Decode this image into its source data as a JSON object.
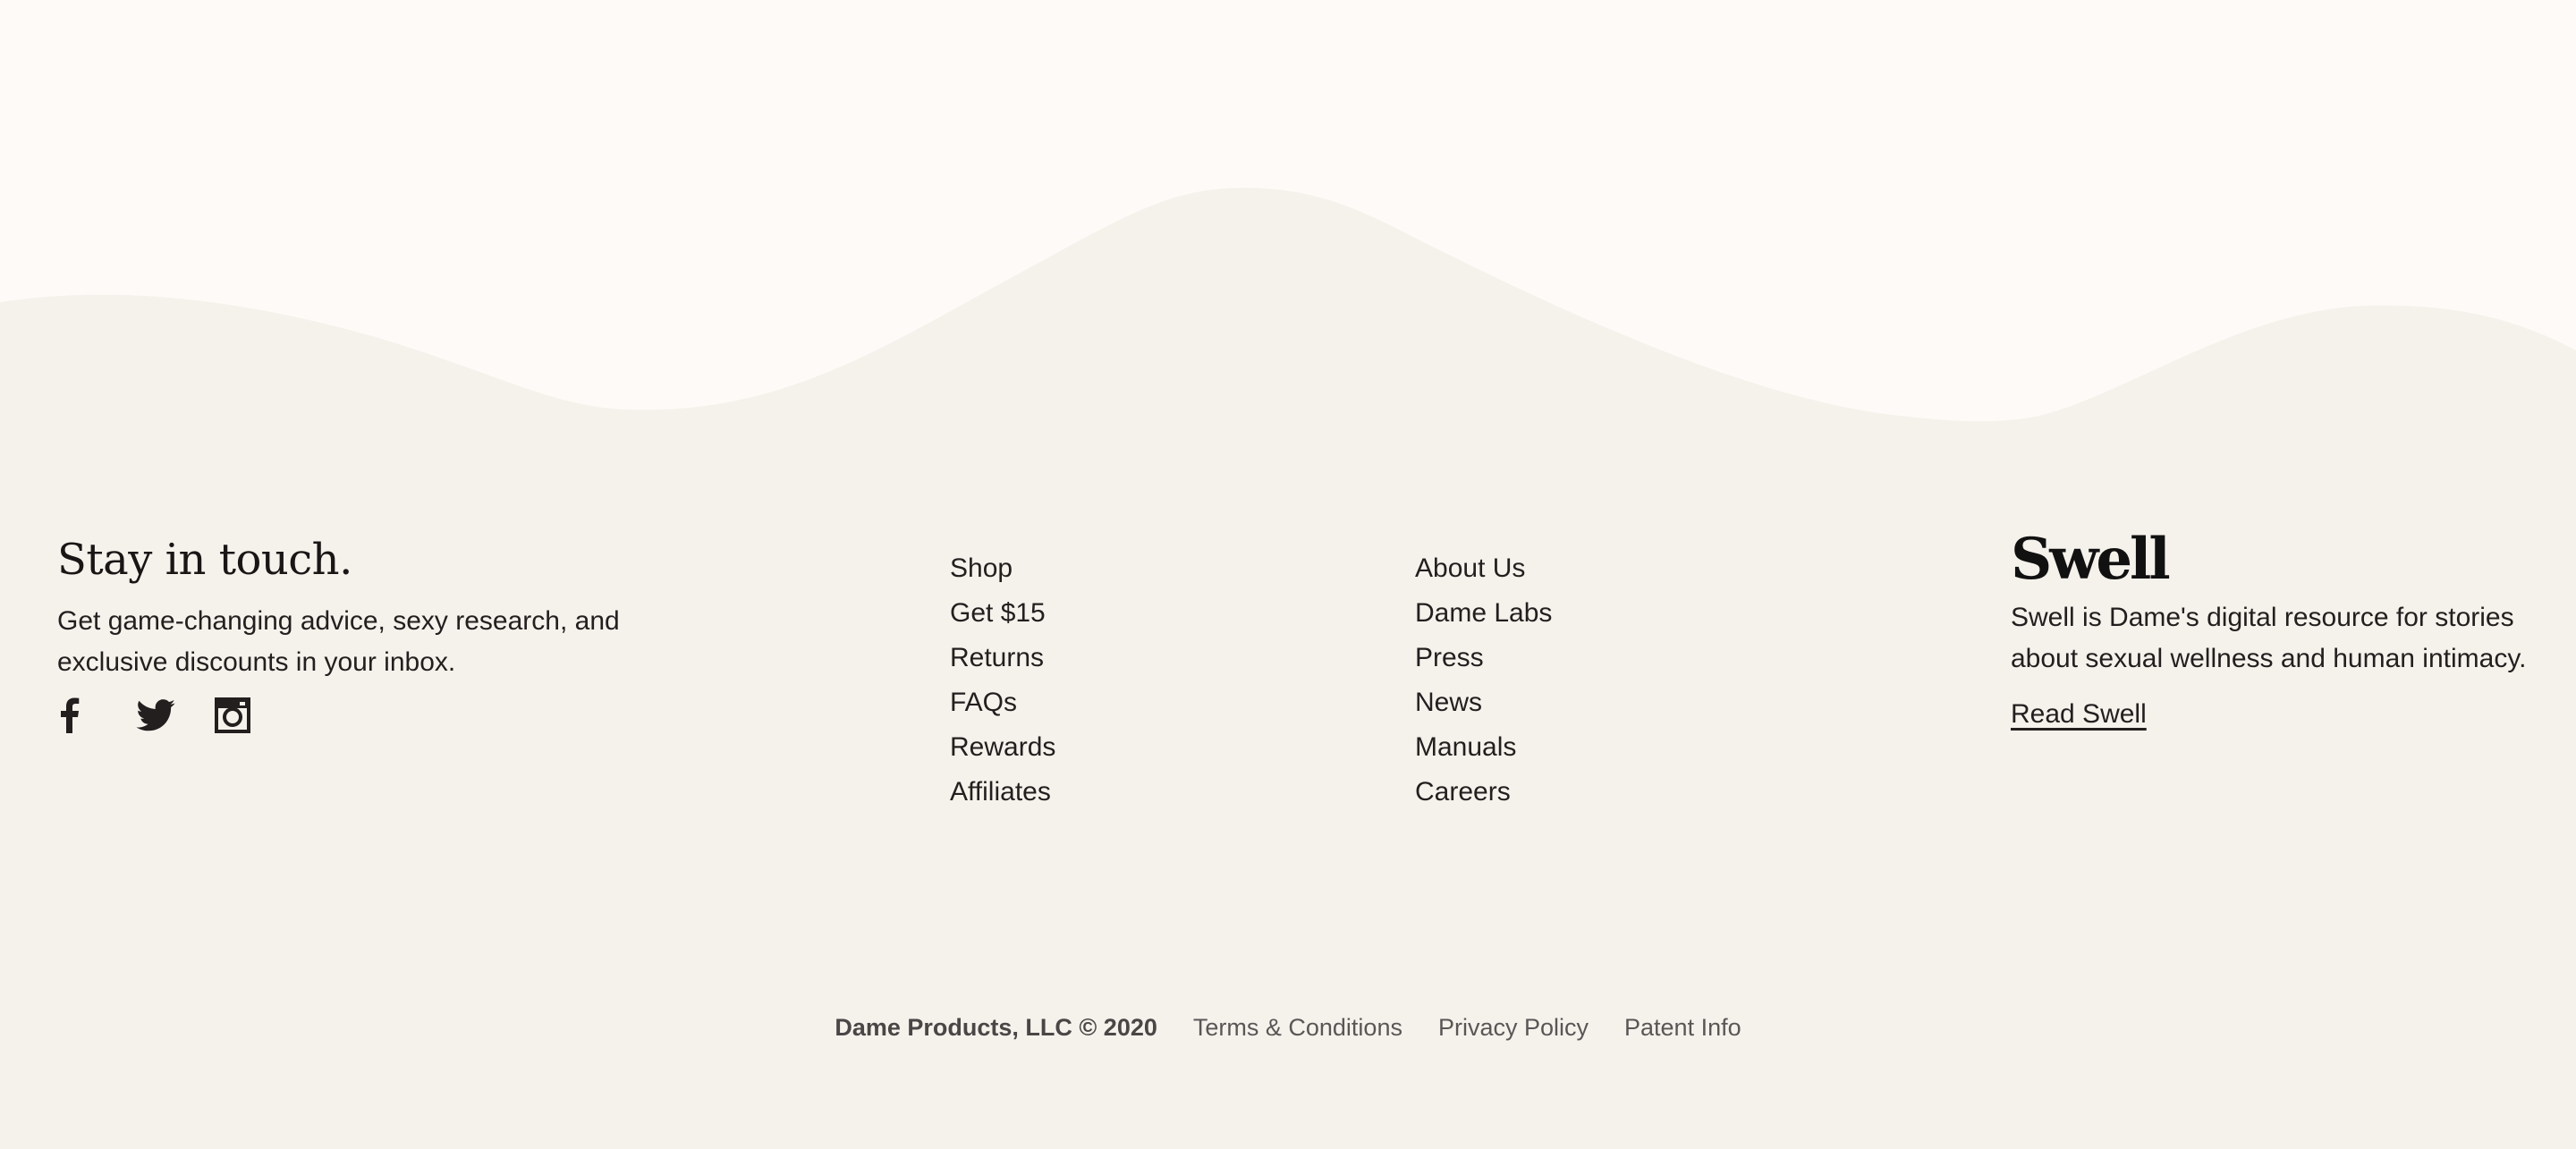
{
  "colors": {
    "page_background": "#fefaf7",
    "footer_background": "#f5f1eb",
    "text": "#231f1f",
    "muted_text": "#5a5656"
  },
  "newsletter": {
    "title": "Stay in touch.",
    "text": "Get game-changing advice, sexy research, and exclusive discounts in your inbox.",
    "social": [
      {
        "icon": "facebook-icon"
      },
      {
        "icon": "twitter-icon"
      },
      {
        "icon": "instagram-icon"
      }
    ]
  },
  "nav_column_1": [
    "Shop",
    "Get $15",
    "Returns",
    "FAQs",
    "Rewards",
    "Affiliates"
  ],
  "nav_column_2": [
    "About Us",
    "Dame Labs",
    "Press",
    "News",
    "Manuals",
    "Careers"
  ],
  "swell": {
    "logo": "Swell",
    "text": "Swell is Dame's digital resource for stories about sexual wellness and human intimacy.",
    "link": "Read Swell"
  },
  "legal": {
    "copyright": "Dame Products, LLC © 2020",
    "terms": "Terms & Conditions",
    "privacy": "Privacy Policy",
    "patent": "Patent Info"
  }
}
